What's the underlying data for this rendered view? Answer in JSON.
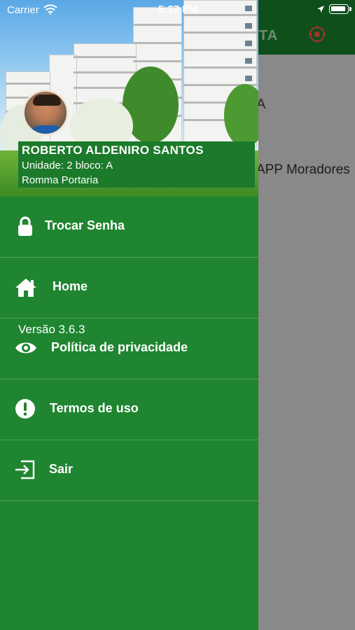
{
  "status_bar": {
    "carrier": "Carrier",
    "time": "5:37 PM"
  },
  "background_screen": {
    "title_fragment": "TA",
    "letter_fragment": "A",
    "subtitle_fragment": "APP Moradores",
    "header_color": "#0f4f1b",
    "icon": "add-circle-icon"
  },
  "drawer": {
    "background_color": "#1f8531",
    "user": {
      "name": "ROBERTO ALDENIRO SANTOS",
      "unit": "Unidade: 2 bloco: A",
      "condo": "Romma Portaria"
    },
    "menu_items": [
      {
        "label": "Trocar Senha",
        "icon": "lock-icon"
      },
      {
        "label": "Home",
        "icon": "home-icon"
      },
      {
        "label": "Política de privacidade",
        "icon": "eye-icon"
      },
      {
        "label": "Termos de uso",
        "icon": "exclamation-circle-icon"
      },
      {
        "label": "Sair",
        "icon": "logout-icon"
      }
    ],
    "version": "Versão 3.6.3"
  }
}
